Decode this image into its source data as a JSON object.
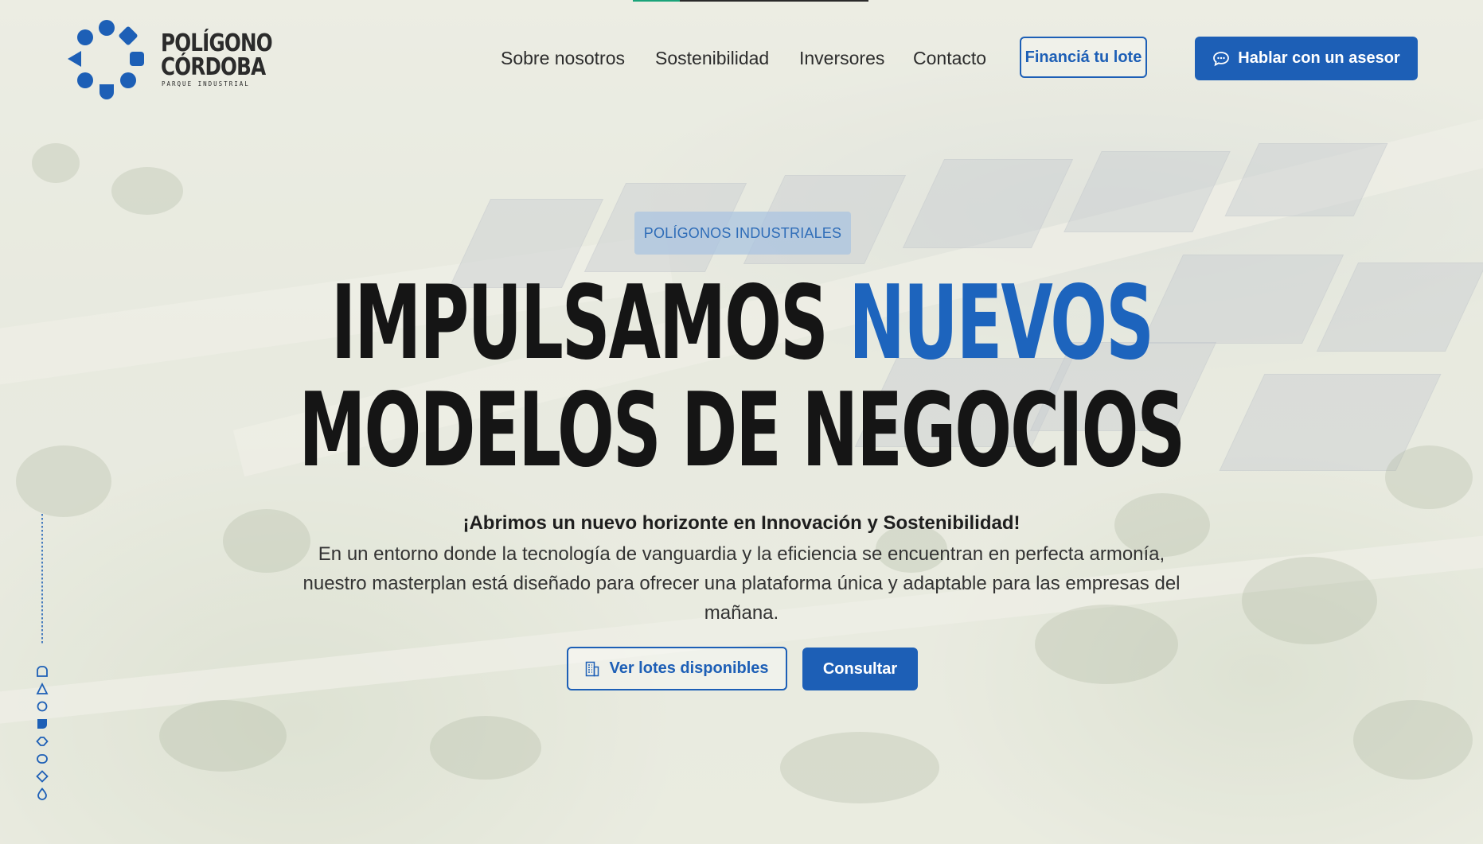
{
  "brand": {
    "name_line1": "POLÍGONO",
    "name_line2": "CÓRDOBA",
    "tagline": "PARQUE INDUSTRIAL",
    "color": "#1d5fb6"
  },
  "progress": {
    "fraction": 0.2
  },
  "nav": {
    "items": [
      "Sobre nosotros",
      "Sostenibilidad",
      "Inversores",
      "Contacto"
    ],
    "finance_button": "Financiá tu lote",
    "advisor_button": "Hablar con un asesor",
    "advisor_icon": "chat-icon"
  },
  "hero": {
    "badge": "POLÍGONOS INDUSTRIALES",
    "headline_part1": "IMPULSAMOS",
    "headline_part2": "NUEVOS",
    "headline_line2": "MODELOS DE NEGOCIOS",
    "lead": "¡Abrimos un nuevo horizonte en Innovación y Sostenibilidad!",
    "paragraph": "En un entorno donde la tecnología de vanguardia y la eficiencia se encuentran en perfecta armonía, nuestro masterplan está diseñado para ofrecer una plataforma única y adaptable para las empresas del mañana.",
    "primary_button": "Ver lotes disponibles",
    "primary_icon": "building-icon",
    "secondary_button": "Consultar"
  },
  "colors": {
    "accent": "#1d5fb6",
    "headline_blue": "#1d64bd",
    "text_dark": "#151515"
  }
}
